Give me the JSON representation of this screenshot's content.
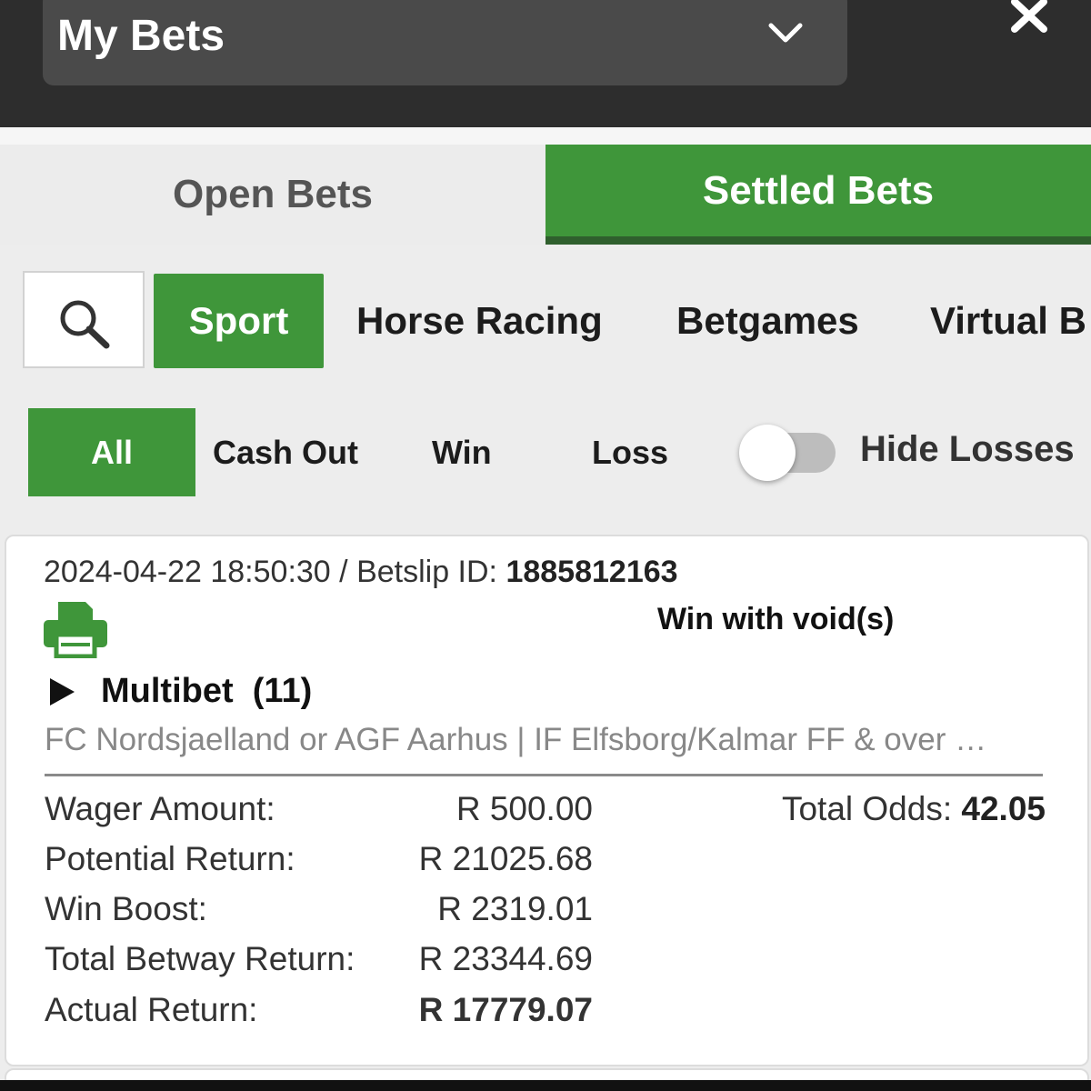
{
  "header": {
    "title": "My Bets"
  },
  "tabs": {
    "open": "Open Bets",
    "settled": "Settled Bets"
  },
  "categories": {
    "sport": "Sport",
    "horse_racing": "Horse Racing",
    "betgames": "Betgames",
    "virtual": "Virtual B"
  },
  "filters": {
    "all": "All",
    "cash_out": "Cash Out",
    "win": "Win",
    "loss": "Loss",
    "hide_losses": "Hide Losses",
    "hide_losses_on": false
  },
  "bet": {
    "datetime": "2024-04-22 18:50:30",
    "separator": " / ",
    "betslip_label": "Betslip ID: ",
    "betslip_id": "1885812163",
    "status": "Win with void(s)",
    "type": "Multibet",
    "legs": "(11)",
    "selections": "FC Nordsjaelland or AGF Aarhus | IF Elfsborg/Kalmar FF & over …",
    "rows": [
      {
        "label": "Wager Amount:",
        "value": "R 500.00"
      },
      {
        "label": "Potential Return:",
        "value": "R 21025.68"
      },
      {
        "label": "Win Boost:",
        "value": "R 2319.01"
      },
      {
        "label": "Total Betway Return:",
        "value": "R 23344.69"
      },
      {
        "label": "Actual Return:",
        "value": "R 17779.07"
      }
    ],
    "total_odds_label": "Total Odds: ",
    "total_odds": "42.05"
  },
  "colors": {
    "accent_green": "#3f963a",
    "header_dark": "#2d2d2d"
  }
}
